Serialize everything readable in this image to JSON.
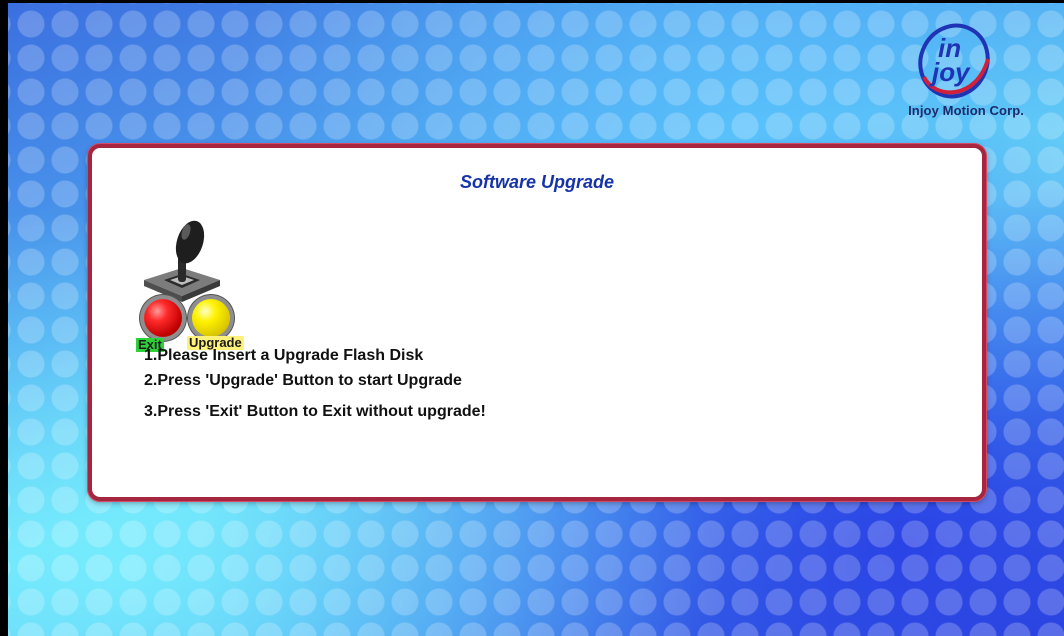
{
  "brand": {
    "company": "Injoy Motion Corp.",
    "logo_word_top": "in",
    "logo_word_bottom": "joy",
    "colors": {
      "logo_blue": "#1f33b5",
      "logo_red": "#d1213a"
    }
  },
  "panel": {
    "title": "Software Upgrade",
    "border_color": "#a6253f",
    "title_color": "#1634a8"
  },
  "controls": {
    "exit_label": "Exit",
    "upgrade_label": "Upgrade",
    "exit_button_color": "#e00000",
    "upgrade_button_color": "#f2e600",
    "exit_label_bg": "#2fd13a",
    "upgrade_label_bg": "#fff27a",
    "icons": [
      "joystick-icon",
      "exit-button-icon",
      "upgrade-button-icon"
    ]
  },
  "instructions": [
    "1.Please Insert a Upgrade Flash Disk",
    "2.Press 'Upgrade' Button to start Upgrade",
    "3.Press 'Exit' Button to Exit without upgrade!"
  ]
}
